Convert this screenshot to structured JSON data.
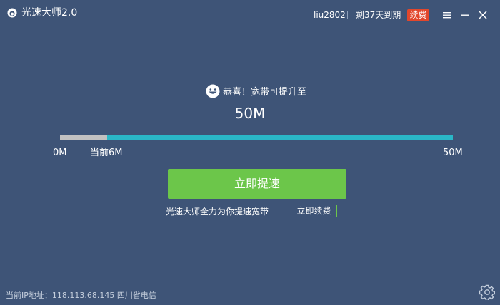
{
  "app": {
    "title": "光速大师2.0"
  },
  "account": {
    "username": "liu2802",
    "expire_text": "剩37天到期",
    "renew_badge": "续费"
  },
  "main": {
    "congrats_text": "恭喜！宽带可提升至",
    "target_speed": "50M",
    "progress": {
      "min_label": "0M",
      "current_label": "当前6M",
      "max_label": "50M",
      "current_mbps": 6,
      "max_mbps": 50
    },
    "boost_button": "立即提速",
    "tagline": "光速大师全力为你提速宽带",
    "renew_link": "立即续费"
  },
  "footer": {
    "ip_info": "当前IP地址：118.113.68.145 四川省电信"
  },
  "icons": {
    "logo": "app-logo-icon",
    "smiley": "smiley-icon",
    "menu": "menu-icon",
    "minimize": "minimize-icon",
    "close": "close-icon",
    "settings": "gear-icon"
  },
  "colors": {
    "background": "#3e5477",
    "progress_fill": "#2ab7c7",
    "progress_current": "#c1c1c1",
    "button_green": "#6cc64a",
    "badge_red": "#e2472c"
  }
}
